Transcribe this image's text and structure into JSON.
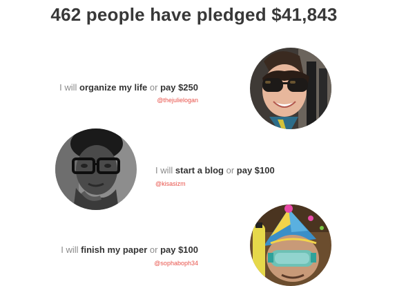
{
  "headline": "462 people have pledged $41,843",
  "pledges": [
    {
      "prefix": "I will",
      "task": "organize my life",
      "conj": "or",
      "amount": "pay $250",
      "handle": "@thejulielogan",
      "avatar": "smiling-woman-sunglasses"
    },
    {
      "prefix": "I will",
      "task": "start a blog",
      "conj": "or",
      "amount": "pay $100",
      "handle": "@kisasizm",
      "avatar": "man-with-glasses"
    },
    {
      "prefix": "I will",
      "task": "finish my paper",
      "conj": "or",
      "amount": "pay $100",
      "handle": "@sophaboph34",
      "avatar": "party-hat-snorkel-mask"
    }
  ],
  "colors": {
    "headline": "#383838",
    "muted_text": "#8a8a8a",
    "bold_text": "#333333",
    "handle": "#e8524a",
    "background": "#ffffff"
  }
}
